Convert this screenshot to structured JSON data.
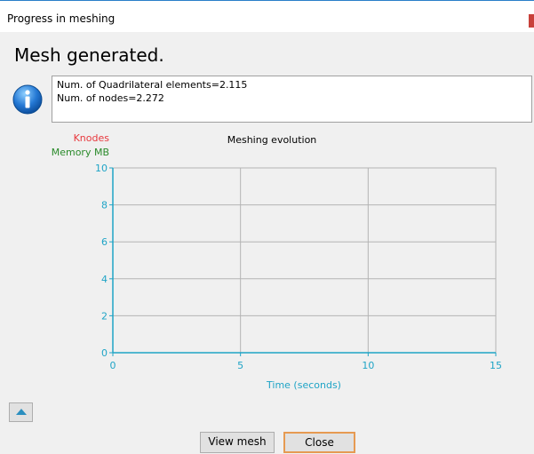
{
  "window": {
    "title": "Progress in meshing"
  },
  "heading": "Mesh generated.",
  "messages": [
    "Num. of Quadrilateral elements=2.115",
    "Num. of nodes=2.272"
  ],
  "chart_data": {
    "type": "line",
    "title": "Meshing evolution",
    "xlabel": "Time (seconds)",
    "ylabels": [
      {
        "text": "Knodes",
        "color": "#e8383d"
      },
      {
        "text": "Memory MB",
        "color": "#2a8a2a"
      }
    ],
    "xlim": [
      0,
      15
    ],
    "ylim": [
      0,
      10
    ],
    "x_ticks": [
      "0",
      "5",
      "10",
      "15"
    ],
    "y_ticks": [
      "0",
      "2",
      "4",
      "6",
      "8",
      "10"
    ],
    "grid": true,
    "axis_color": "#1fa4c6",
    "series": []
  },
  "buttons": {
    "view_mesh": "View mesh",
    "close": "Close"
  },
  "icons": {
    "info": "info-icon",
    "collapse": "triangle-up-icon"
  }
}
